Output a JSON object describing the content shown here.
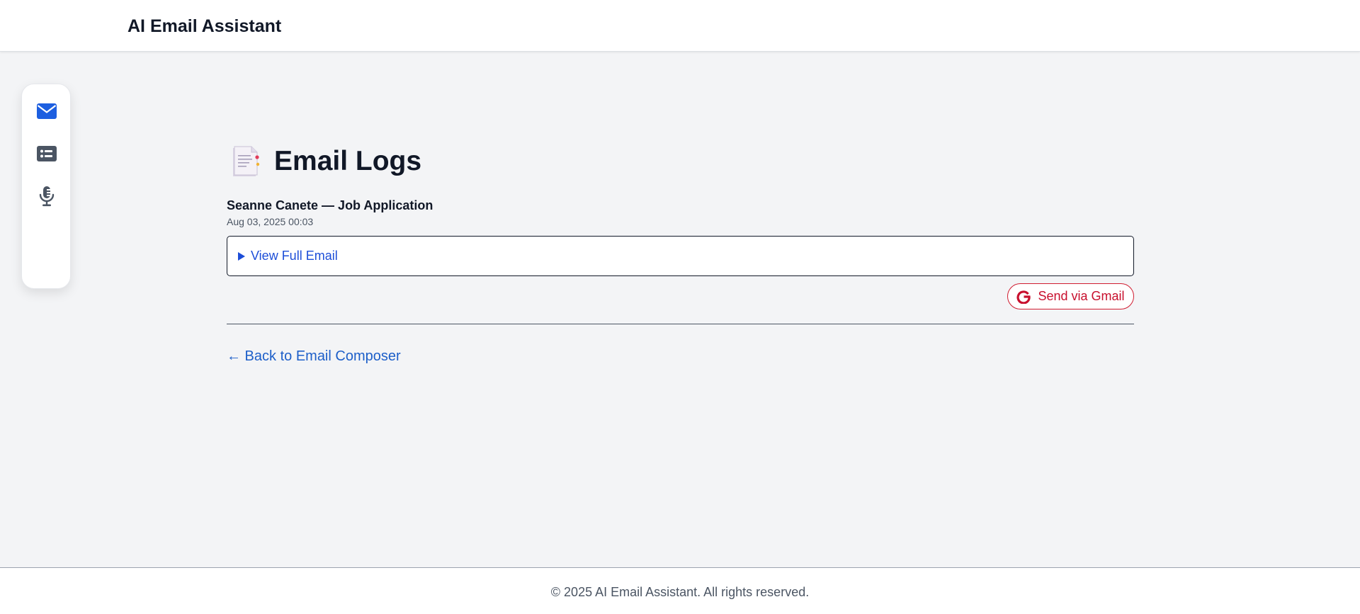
{
  "header": {
    "app_title": "AI Email Assistant"
  },
  "sidebar": {
    "items": [
      {
        "icon": "envelope-icon",
        "active": true
      },
      {
        "icon": "list-card-icon",
        "active": false
      },
      {
        "icon": "microphone-icon",
        "active": false
      }
    ]
  },
  "page": {
    "title": "Email Logs",
    "title_icon": "notepad-icon"
  },
  "log_entry": {
    "subject": "Seanne Canete — Job Application",
    "date": "Aug 03, 2025 00:03",
    "details_label": "View Full Email",
    "send_label": "Send via Gmail"
  },
  "nav": {
    "back_label": "← Back to Email Composer"
  },
  "footer": {
    "text": "© 2025 AI Email Assistant. All rights reserved."
  },
  "colors": {
    "accent_blue": "#1d4ed8",
    "gmail_red": "#c8102e",
    "icon_gray": "#4b5563",
    "background": "#f3f4f6"
  }
}
